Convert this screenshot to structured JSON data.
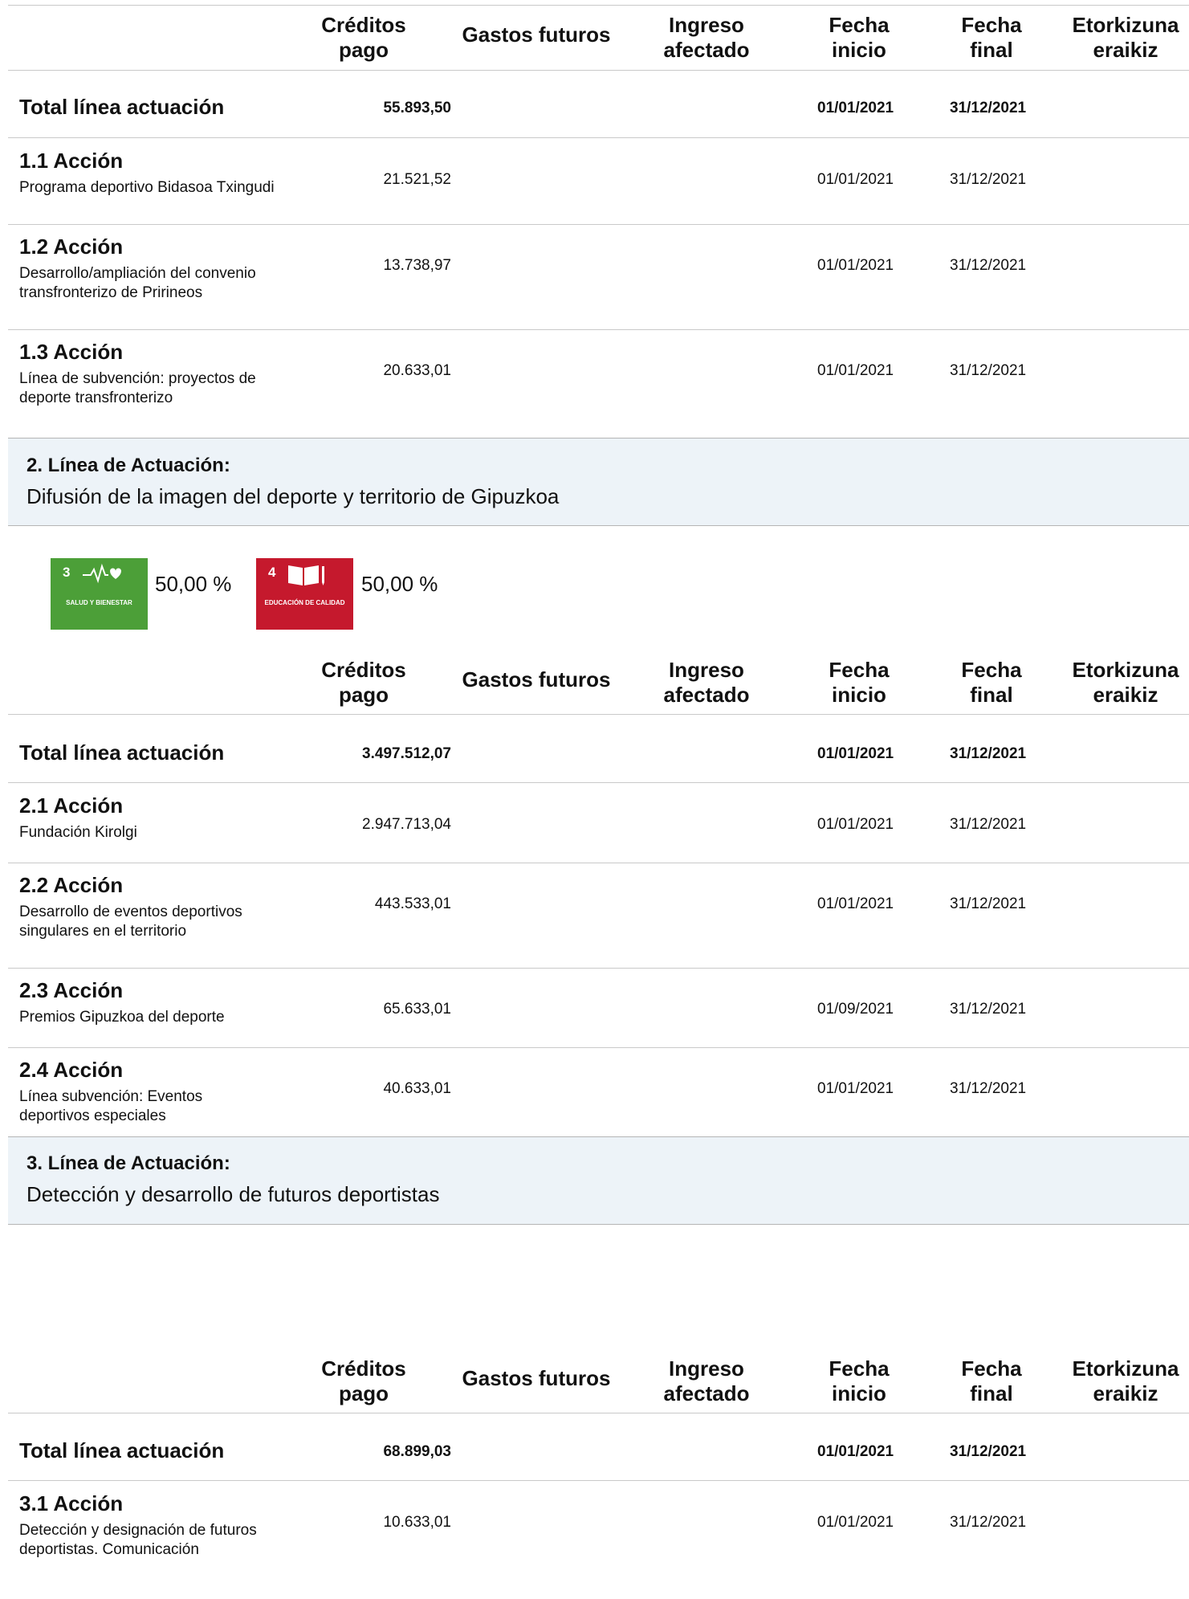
{
  "columns": {
    "creditos": "Créditos pago",
    "gastos": "Gastos futuros",
    "ingreso": "Ingreso afectado",
    "fecha_inicio": "Fecha inicio",
    "fecha_final": "Fecha final",
    "etorkizuna": "Etorkizuna eraikiz"
  },
  "section1": {
    "total": {
      "label": "Total línea actuación",
      "creditos": "55.893,50",
      "inicio": "01/01/2021",
      "final": "31/12/2021"
    },
    "actions": [
      {
        "title": "1.1 Acción",
        "desc": "Programa deportivo Bidasoa Txingudi",
        "creditos": "21.521,52",
        "inicio": "01/01/2021",
        "final": "31/12/2021"
      },
      {
        "title": "1.2 Acción",
        "desc": "Desarrollo/ampliación del convenio transfronterizo de Pririneos",
        "creditos": "13.738,97",
        "inicio": "01/01/2021",
        "final": "31/12/2021"
      },
      {
        "title": "1.3 Acción",
        "desc": "Línea de subvención: proyectos de deporte transfronterizo",
        "creditos": "20.633,01",
        "inicio": "01/01/2021",
        "final": "31/12/2021"
      }
    ]
  },
  "section2": {
    "band": {
      "title": "2. Línea de Actuación:",
      "subtitle": "Difusión de la imagen del deporte y territorio de Gipuzkoa"
    },
    "sdgs": [
      {
        "number": "3",
        "caption": "SALUD Y BIENESTAR",
        "percent": "50,00 %",
        "color": "#4c9f38",
        "icon": "heartbeat-icon"
      },
      {
        "number": "4",
        "caption": "EDUCACIÓN DE CALIDAD",
        "percent": "50,00 %",
        "color": "#c5192d",
        "icon": "book-pencil-icon"
      }
    ],
    "total": {
      "label": "Total línea actuación",
      "creditos": "3.497.512,07",
      "inicio": "01/01/2021",
      "final": "31/12/2021"
    },
    "actions": [
      {
        "title": "2.1 Acción",
        "desc": "Fundación Kirolgi",
        "creditos": "2.947.713,04",
        "inicio": "01/01/2021",
        "final": "31/12/2021"
      },
      {
        "title": "2.2 Acción",
        "desc": "Desarrollo de eventos deportivos singulares en el territorio",
        "creditos": "443.533,01",
        "inicio": "01/01/2021",
        "final": "31/12/2021"
      },
      {
        "title": "2.3 Acción",
        "desc": "Premios Gipuzkoa del deporte",
        "creditos": "65.633,01",
        "inicio": "01/09/2021",
        "final": "31/12/2021"
      },
      {
        "title": "2.4 Acción",
        "desc": "Línea subvención: Eventos deportivos especiales",
        "creditos": "40.633,01",
        "inicio": "01/01/2021",
        "final": "31/12/2021"
      }
    ]
  },
  "section3": {
    "band": {
      "title": "3. Línea de Actuación:",
      "subtitle": "Detección y desarrollo de futuros deportistas"
    },
    "total": {
      "label": "Total línea actuación",
      "creditos": "68.899,03",
      "inicio": "01/01/2021",
      "final": "31/12/2021"
    },
    "actions": [
      {
        "title": "3.1 Acción",
        "desc": "Detección y designación de futuros deportistas. Comunicación",
        "creditos": "10.633,01",
        "inicio": "01/01/2021",
        "final": "31/12/2021"
      }
    ]
  }
}
